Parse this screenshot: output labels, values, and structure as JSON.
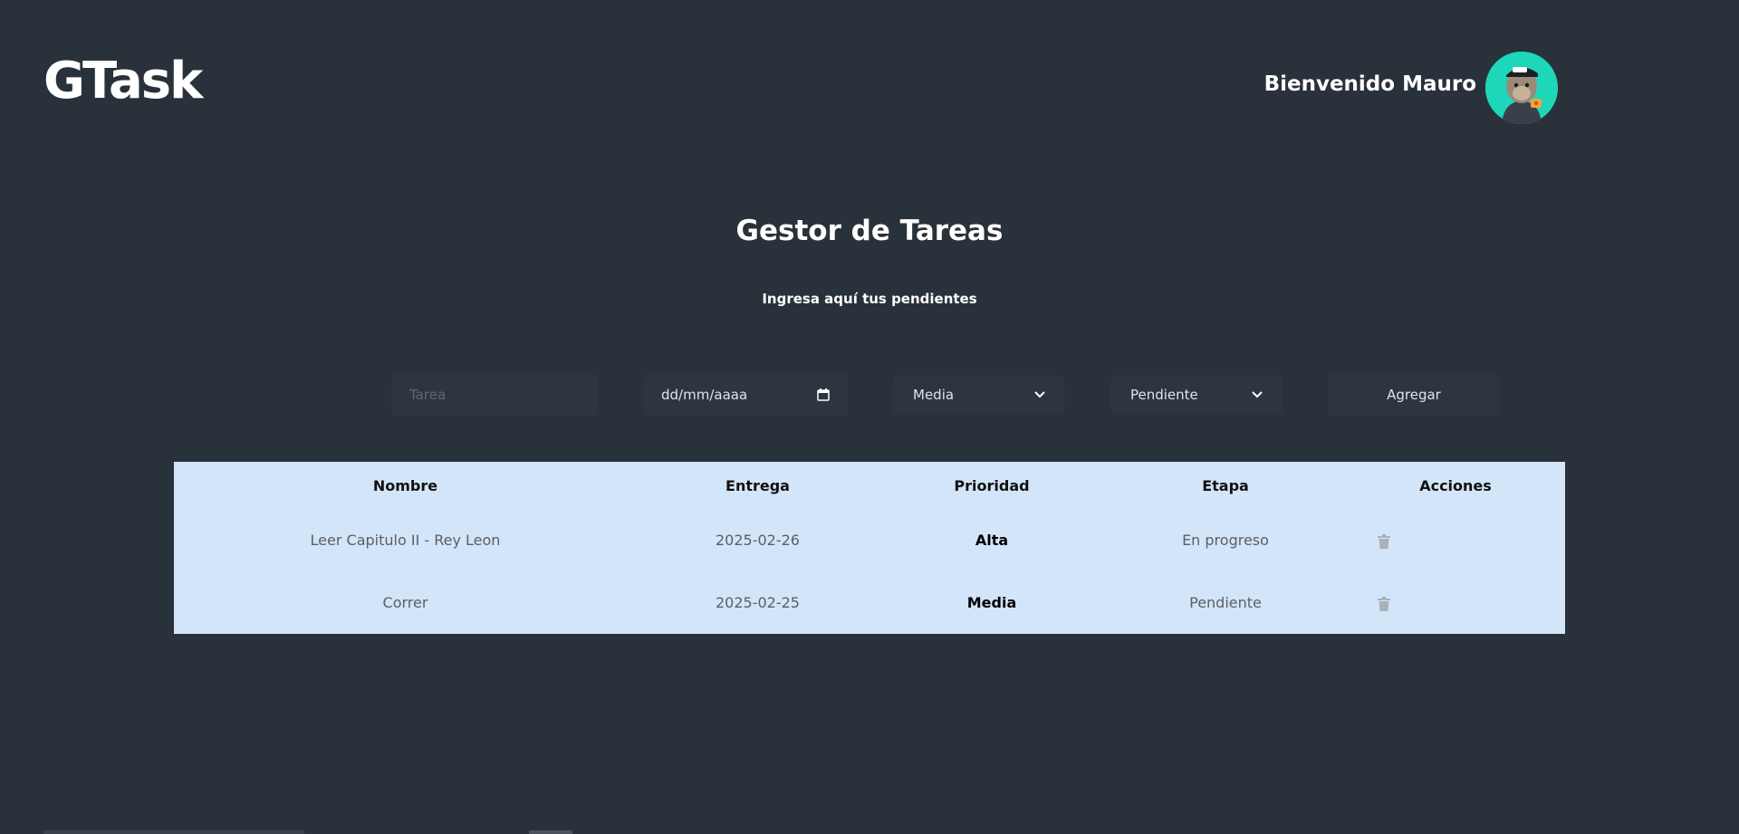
{
  "header": {
    "logo": "GTask",
    "welcome": "Bienvenido Mauro",
    "avatar_icon": "ape-avatar-icon"
  },
  "main": {
    "title": "Gestor de Tareas",
    "subtitle": "Ingresa aquí tus pendientes"
  },
  "form": {
    "task_placeholder": "Tarea",
    "date_placeholder": "dd/mm/aaaa",
    "priority_selected": "Media",
    "stage_selected": "Pendiente",
    "add_label": "Agregar"
  },
  "table": {
    "headers": [
      "Nombre",
      "Entrega",
      "Prioridad",
      "Etapa",
      "Acciones"
    ],
    "rows": [
      {
        "name": "Leer Capitulo II - Rey Leon",
        "date": "2025-02-26",
        "priority": "Alta",
        "stage": "En progreso"
      },
      {
        "name": "Correr",
        "date": "2025-02-25",
        "priority": "Media",
        "stage": "Pendiente"
      }
    ]
  },
  "colors": {
    "background": "#29313a",
    "table_background": "#d3e5f8",
    "avatar_background": "#1ed7b9"
  }
}
